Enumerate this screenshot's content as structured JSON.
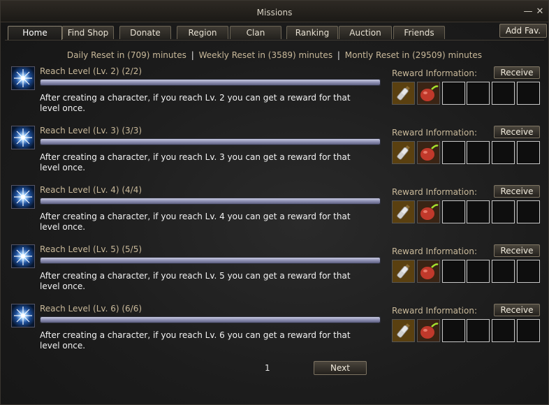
{
  "window": {
    "title": "Missions",
    "minimize_glyph": "—",
    "close_glyph": "✕"
  },
  "tabs": [
    {
      "label": "Home",
      "active": true
    },
    {
      "label": "Find Shop",
      "active": false
    },
    {
      "label": "Donate",
      "active": false
    },
    {
      "label": "Region",
      "active": false
    },
    {
      "label": "Clan",
      "active": false
    },
    {
      "label": "Ranking",
      "active": false
    },
    {
      "label": "Auction",
      "active": false
    },
    {
      "label": "Friends",
      "active": false
    }
  ],
  "add_fav_label": "Add Fav.",
  "reset": {
    "daily": "Daily Reset in (709) minutes",
    "weekly": "Weekly Reset in (3589) minutes",
    "monthly": "Montly Reset in (29509) minutes",
    "separator": "|"
  },
  "missions": [
    {
      "title": "Reach Level (Lv. 2) (2/2)",
      "progress": 1.0,
      "description": "After creating a character, if you reach Lv. 2 you can get a reward for that level once.",
      "reward_label": "Reward Information:",
      "receive_label": "Receive",
      "reward_items": [
        "potion-icon",
        "fruit-icon"
      ],
      "empty_slots": 4
    },
    {
      "title": "Reach Level (Lv. 3) (3/3)",
      "progress": 1.0,
      "description": "After creating a character, if you reach Lv. 3 you can get a reward for that level once.",
      "reward_label": "Reward Information:",
      "receive_label": "Receive",
      "reward_items": [
        "potion-icon",
        "fruit-icon"
      ],
      "empty_slots": 4
    },
    {
      "title": "Reach Level (Lv. 4) (4/4)",
      "progress": 1.0,
      "description": "After creating a character, if you reach Lv. 4 you can get a reward for that level once.",
      "reward_label": "Reward Information:",
      "receive_label": "Receive",
      "reward_items": [
        "potion-icon",
        "fruit-icon"
      ],
      "empty_slots": 4
    },
    {
      "title": "Reach Level (Lv. 5) (5/5)",
      "progress": 1.0,
      "description": "After creating a character, if you reach Lv. 5 you can get a reward for that level once.",
      "reward_label": "Reward Information:",
      "receive_label": "Receive",
      "reward_items": [
        "potion-icon",
        "fruit-icon"
      ],
      "empty_slots": 4
    },
    {
      "title": "Reach Level (Lv. 6) (6/6)",
      "progress": 1.0,
      "description": "After creating a character, if you reach Lv. 6 you can get a reward for that level once.",
      "reward_label": "Reward Information:",
      "receive_label": "Receive",
      "reward_items": [
        "potion-icon",
        "fruit-icon"
      ],
      "empty_slots": 4
    }
  ],
  "pagination": {
    "current_page": "1",
    "next_label": "Next"
  },
  "colors": {
    "gold_text": "#c9b99a",
    "bar_fill": "#8e90b4",
    "button_border": "#7d7463"
  }
}
